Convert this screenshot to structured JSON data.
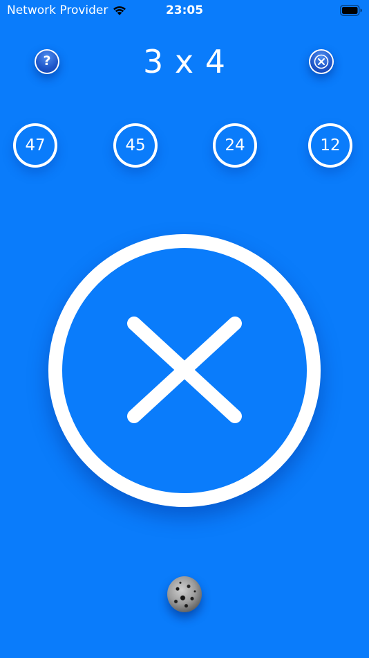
{
  "status_bar": {
    "carrier": "Network Provider",
    "time": "23:05"
  },
  "header": {
    "title": "3 x 4",
    "help_label": "?"
  },
  "answers": {
    "choices": [
      "47",
      "45",
      "24",
      "12"
    ]
  },
  "result": {
    "icon": "wrong-x-icon",
    "state": "incorrect"
  },
  "colors": {
    "background": "#0a7cfb",
    "foreground": "#ffffff"
  }
}
